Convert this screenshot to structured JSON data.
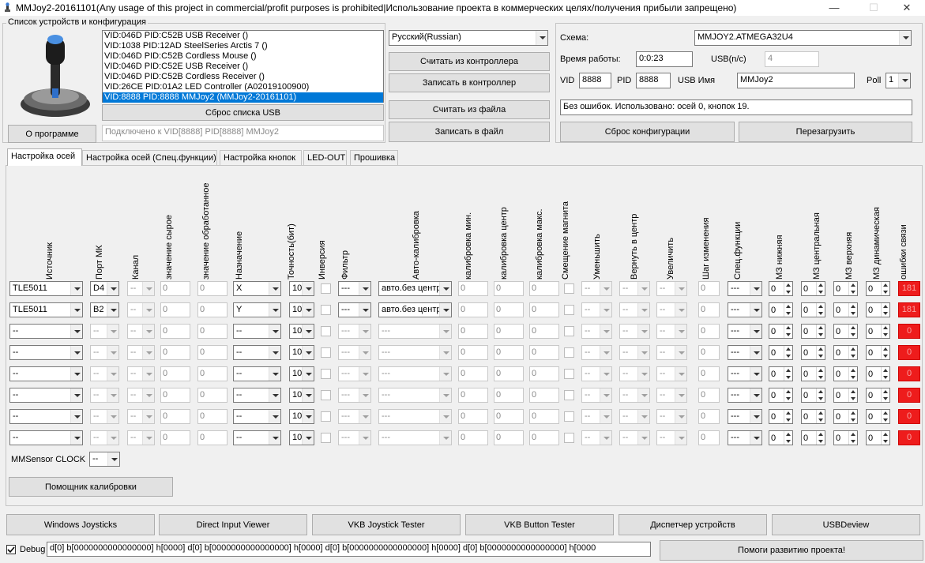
{
  "window": {
    "title": "MMJoy2-20161101(Any usage of this project in commercial/profit purposes is prohibited|Использование проекта в коммерческих целях/получения прибыли запрещено)",
    "minimize": "—",
    "maximize": "☐",
    "close": "✕"
  },
  "devices": {
    "group_label": "Список устройств и конфигурация",
    "items": [
      "VID:046D PID:C52B USB Receiver ()",
      "VID:1038 PID:12AD SteelSeries Arctis 7 ()",
      "VID:046D PID:C52B Cordless Mouse ()",
      "VID:046D PID:C52E USB Receiver ()",
      "VID:046D PID:C52B Cordless Receiver ()",
      "VID:26CE PID:01A2 LED Controller (A02019100900)",
      "VID:8888 PID:8888 MMJoy2 (MMJoy2-20161101)"
    ],
    "reset_usb": "Сброс списка USB",
    "about": "О программе",
    "connected": "Подключено к VID[8888] PID[8888] MMJoy2"
  },
  "controls": {
    "language": "Русский(Russian)",
    "read_controller": "Считать из контроллера",
    "write_controller": "Записать в контроллер",
    "read_file": "Считать из файла",
    "write_file": "Записать в файл"
  },
  "config": {
    "schema_label": "Схема:",
    "schema_value": "MMJOY2.ATMEGA32U4",
    "uptime_label": "Время работы:",
    "uptime_value": "0:0:23",
    "usb_ms_label": "USB(n/c)",
    "usb_ms_value": "4",
    "vid_label": "VID",
    "vid_value": "8888",
    "pid_label": "PID",
    "pid_value": "8888",
    "usb_name_label": "USB Имя",
    "usb_name_value": "MMJoy2",
    "poll_label": "Poll",
    "poll_value": "1",
    "status": "Без ошибок. Использовано: осей  0, кнопок  19.",
    "reset_config": "Сброс конфигурации",
    "reboot": "Перезагрузить"
  },
  "tabs": [
    "Настройка осей",
    "Настройка осей (Спец.функции)",
    "Настройка кнопок",
    "LED-OUT",
    "Прошивка"
  ],
  "axis_headers": [
    "Источник",
    "Порт МК",
    "Канал",
    "значение сырое",
    "значение обработанное",
    "Назначение",
    "Точность(бит)",
    "Инверсия",
    "Фильтр",
    "Авто-калибровка",
    "калибровка мин.",
    "калибровка центр",
    "калибровка макс.",
    "Смещение магнита",
    "Уменьшить",
    "Вернуть в центр",
    "Увеличить",
    "Шаг изменения",
    "Спец.функции",
    "МЗ нижняя",
    "МЗ центральная",
    "МЗ верхняя",
    "МЗ динамическая",
    "ошибки связи"
  ],
  "axis_rows": [
    {
      "source": "TLE5011",
      "port": "D4",
      "channel": "--",
      "raw": "0",
      "proc": "0",
      "assign": "X",
      "bits": "10",
      "filter": "---",
      "autocal": "авто.без центр",
      "cmin": "0",
      "ccen": "0",
      "cmax": "0",
      "dec": "--",
      "ret": "--",
      "inc": "--",
      "step": "0",
      "spec": "---",
      "dzl": "0",
      "dzc": "0",
      "dzu": "0",
      "dzd": "0",
      "err": "181"
    },
    {
      "source": "TLE5011",
      "port": "B2",
      "channel": "--",
      "raw": "0",
      "proc": "0",
      "assign": "Y",
      "bits": "10",
      "filter": "---",
      "autocal": "авто.без центр",
      "cmin": "0",
      "ccen": "0",
      "cmax": "0",
      "dec": "--",
      "ret": "--",
      "inc": "--",
      "step": "0",
      "spec": "---",
      "dzl": "0",
      "dzc": "0",
      "dzu": "0",
      "dzd": "0",
      "err": "181"
    },
    {
      "source": "--",
      "port": "--",
      "channel": "--",
      "raw": "0",
      "proc": "0",
      "assign": "--",
      "bits": "10",
      "filter": "---",
      "autocal": "---",
      "cmin": "0",
      "ccen": "0",
      "cmax": "0",
      "dec": "--",
      "ret": "--",
      "inc": "--",
      "step": "0",
      "spec": "---",
      "dzl": "0",
      "dzc": "0",
      "dzu": "0",
      "dzd": "0",
      "err": "0"
    },
    {
      "source": "--",
      "port": "--",
      "channel": "--",
      "raw": "0",
      "proc": "0",
      "assign": "--",
      "bits": "10",
      "filter": "---",
      "autocal": "---",
      "cmin": "0",
      "ccen": "0",
      "cmax": "0",
      "dec": "--",
      "ret": "--",
      "inc": "--",
      "step": "0",
      "spec": "---",
      "dzl": "0",
      "dzc": "0",
      "dzu": "0",
      "dzd": "0",
      "err": "0"
    },
    {
      "source": "--",
      "port": "--",
      "channel": "--",
      "raw": "0",
      "proc": "0",
      "assign": "--",
      "bits": "10",
      "filter": "---",
      "autocal": "---",
      "cmin": "0",
      "ccen": "0",
      "cmax": "0",
      "dec": "--",
      "ret": "--",
      "inc": "--",
      "step": "0",
      "spec": "---",
      "dzl": "0",
      "dzc": "0",
      "dzu": "0",
      "dzd": "0",
      "err": "0"
    },
    {
      "source": "--",
      "port": "--",
      "channel": "--",
      "raw": "0",
      "proc": "0",
      "assign": "--",
      "bits": "10",
      "filter": "---",
      "autocal": "---",
      "cmin": "0",
      "ccen": "0",
      "cmax": "0",
      "dec": "--",
      "ret": "--",
      "inc": "--",
      "step": "0",
      "spec": "---",
      "dzl": "0",
      "dzc": "0",
      "dzu": "0",
      "dzd": "0",
      "err": "0"
    },
    {
      "source": "--",
      "port": "--",
      "channel": "--",
      "raw": "0",
      "proc": "0",
      "assign": "--",
      "bits": "10",
      "filter": "---",
      "autocal": "---",
      "cmin": "0",
      "ccen": "0",
      "cmax": "0",
      "dec": "--",
      "ret": "--",
      "inc": "--",
      "step": "0",
      "spec": "---",
      "dzl": "0",
      "dzc": "0",
      "dzu": "0",
      "dzd": "0",
      "err": "0"
    },
    {
      "source": "--",
      "port": "--",
      "channel": "--",
      "raw": "0",
      "proc": "0",
      "assign": "--",
      "bits": "10",
      "filter": "---",
      "autocal": "---",
      "cmin": "0",
      "ccen": "0",
      "cmax": "0",
      "dec": "--",
      "ret": "--",
      "inc": "--",
      "step": "0",
      "spec": "---",
      "dzl": "0",
      "dzc": "0",
      "dzu": "0",
      "dzd": "0",
      "err": "0"
    }
  ],
  "mmsensor": {
    "label": "MMSensor CLOCK",
    "value": "--"
  },
  "calib_helper": "Помощник калибровки",
  "bottom_buttons": [
    "Windows Joysticks",
    "Direct Input Viewer",
    "VKB Joystick Tester",
    "VKB Button Tester",
    "Диспетчер устройств",
    "USBDeview"
  ],
  "debug": {
    "label": "Debug",
    "text": "d[0] b[0000000000000000] h[0000]    d[0] b[0000000000000000] h[0000]    d[0] b[0000000000000000] h[0000]    d[0] b[0000000000000000] h[0000"
  },
  "help_project": "Помоги развитию проекта!",
  "colors": {
    "error_red": "#ee1c1c",
    "selection": "#0078d7"
  }
}
